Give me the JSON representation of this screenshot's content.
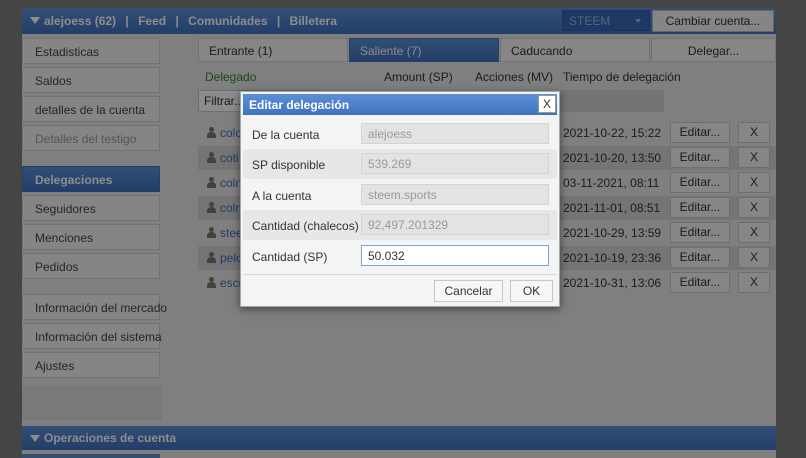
{
  "topbar": {
    "account": "alejoess (62)",
    "sep": "|",
    "links": [
      "Feed",
      "Comunidades",
      "Billetera"
    ],
    "network": "STEEM",
    "switch_label": "Cambiar cuenta..."
  },
  "sidebar": {
    "items": [
      {
        "label": "Estadisticas",
        "state": "normal"
      },
      {
        "label": "Saldos",
        "state": "normal"
      },
      {
        "label": "detalles de la cuenta",
        "state": "normal"
      },
      {
        "label": "Detalles del testigo",
        "state": "disabled"
      },
      {
        "label": "Delegaciones",
        "state": "active"
      },
      {
        "label": "Seguidores",
        "state": "normal"
      },
      {
        "label": "Menciones",
        "state": "normal"
      },
      {
        "label": "Pedidos",
        "state": "normal"
      },
      {
        "label": "Información del mercado",
        "state": "normal"
      },
      {
        "label": "Información del sistema",
        "state": "normal"
      },
      {
        "label": "Ajustes",
        "state": "normal"
      }
    ]
  },
  "tabs": [
    {
      "label": "Entrante (1)"
    },
    {
      "label": "Saliente (7)",
      "active": true
    },
    {
      "label": "Caducando"
    },
    {
      "label": "Delegar..."
    }
  ],
  "table": {
    "headers": {
      "delegated": "Delegado",
      "amount": "Amount (SP)",
      "shares": "Acciones (MV)",
      "time": "Tiempo de delegación"
    },
    "filter_placeholder": "Filtrar...",
    "rows": [
      {
        "user": "colc",
        "date": "2021-10-22, 15:22"
      },
      {
        "user": "coti",
        "date": "2021-10-20, 13:50"
      },
      {
        "user": "coln",
        "date": "03-11-2021, 08:11"
      },
      {
        "user": "coln",
        "date": "2021-11-01, 08:51"
      },
      {
        "user": "stee",
        "date": "2021-10-29, 13:59"
      },
      {
        "user": "pelc",
        "date": "2021-10-19, 23:36"
      },
      {
        "user": "escr",
        "date": "2021-10-31, 13:06"
      }
    ],
    "edit_label": "Editar...",
    "remove_label": "X"
  },
  "ops_section": {
    "title": "Operaciones de cuenta"
  },
  "dialog": {
    "title": "Editar delegación",
    "close_label": "X",
    "fields": {
      "from_label": "De la cuenta",
      "from_value": "alejoess",
      "avail_label": "SP disponible",
      "avail_value": "539.269",
      "to_label": "A la cuenta",
      "to_value": "steem.sports",
      "vests_label": "Cantidad (chalecos)",
      "vests_value": "92,497.201329",
      "sp_label": "Cantidad (SP)",
      "sp_value": "50.032"
    },
    "cancel_label": "Cancelar",
    "ok_label": "OK"
  }
}
